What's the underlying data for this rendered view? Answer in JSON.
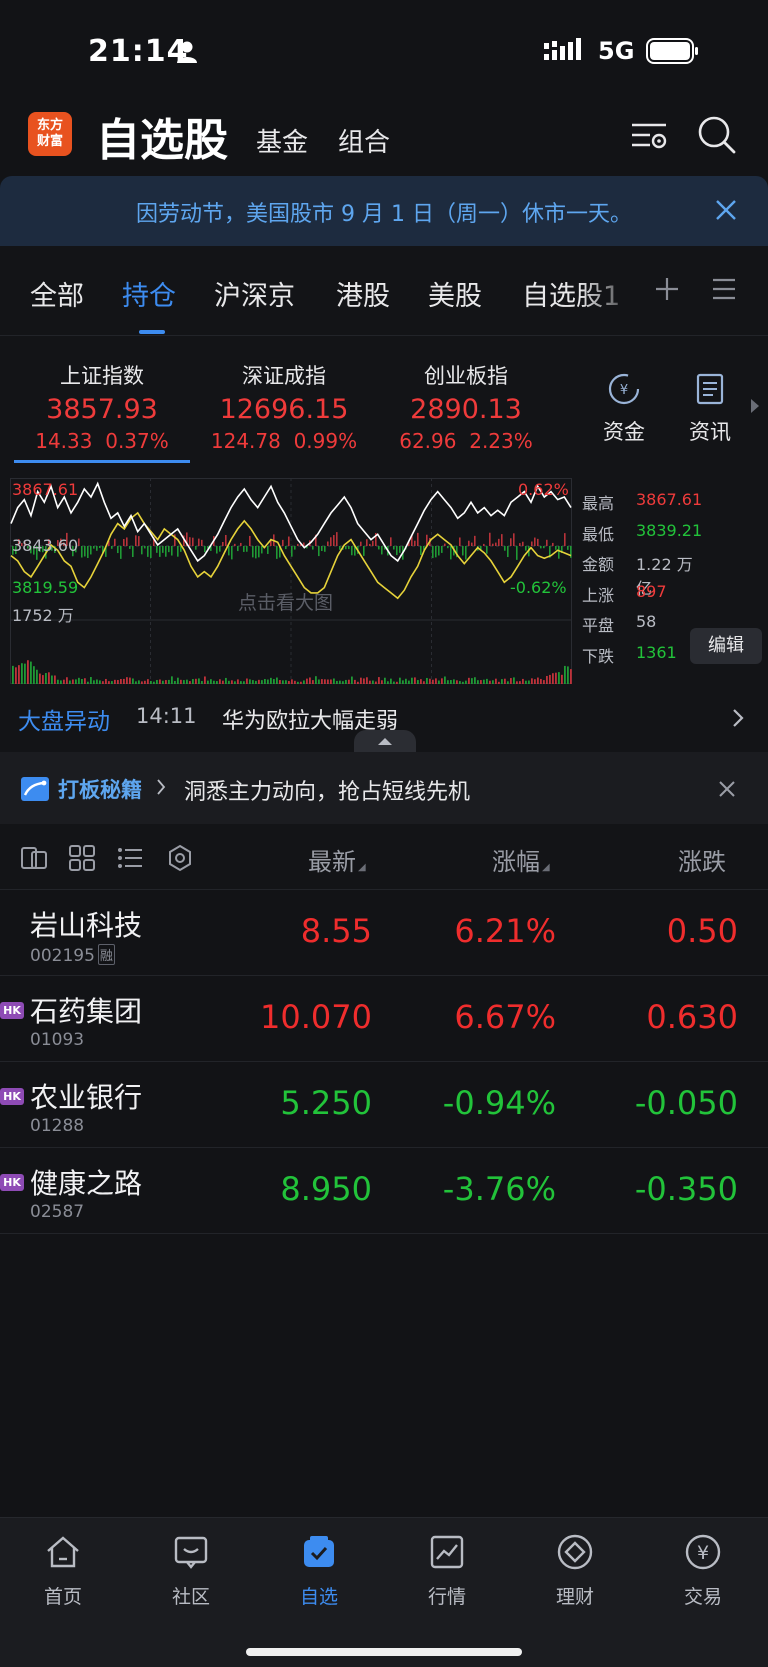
{
  "status_bar": {
    "time": "21:14",
    "network": "5G"
  },
  "header": {
    "logo_text": "东方\n财富",
    "title": "自选股",
    "tabs": [
      "基金",
      "组合"
    ]
  },
  "banner": {
    "text": "因劳动节，美国股市 9 月 1 日（周一）休市一天。"
  },
  "tabs": {
    "items": [
      "全部",
      "持仓",
      "沪深京",
      "港股",
      "美股",
      "自选股1"
    ],
    "active": "持仓"
  },
  "indices": [
    {
      "name": "上证指数",
      "value": "3857.93",
      "change": "14.33",
      "pct": "0.37%"
    },
    {
      "name": "深证成指",
      "value": "12696.15",
      "change": "124.78",
      "pct": "0.99%"
    },
    {
      "name": "创业板指",
      "value": "2890.13",
      "change": "62.96",
      "pct": "2.23%"
    }
  ],
  "quick_buttons": [
    {
      "label": "资金",
      "icon": "capital-flow-icon"
    },
    {
      "label": "资讯",
      "icon": "news-icon"
    }
  ],
  "chart": {
    "y_high": "3867.61",
    "y_mid": "3843.60",
    "y_low": "3819.59",
    "pct_high": "0.62%",
    "pct_low": "-0.62%",
    "volume_label": "1752 万",
    "hint": "点击看大图"
  },
  "chart_data": {
    "type": "line",
    "ylim": [
      3819.59,
      3867.61
    ],
    "series": [
      {
        "values": [
          3852,
          3858,
          3861,
          3855,
          3864,
          3860,
          3866,
          3858,
          3862,
          3856,
          3860,
          3865,
          3862,
          3867,
          3860,
          3854,
          3856,
          3851,
          3855,
          3849,
          3852,
          3848,
          3844,
          3846,
          3848,
          3850,
          3846,
          3842,
          3838,
          3840,
          3844,
          3848,
          3853,
          3858,
          3862,
          3865,
          3861,
          3858,
          3862,
          3866,
          3860,
          3856,
          3851,
          3846,
          3843,
          3845,
          3848,
          3852,
          3856,
          3859,
          3862,
          3858,
          3852,
          3849,
          3846,
          3848,
          3844,
          3840,
          3838,
          3842,
          3847,
          3852,
          3857,
          3861,
          3864,
          3861,
          3858,
          3854,
          3856,
          3860,
          3856,
          3858,
          3855,
          3857,
          3855,
          3860,
          3862,
          3864,
          3860,
          3866,
          3862,
          3864,
          3861,
          3862,
          3858
        ]
      },
      {
        "values": [
          3840,
          3838,
          3834,
          3832,
          3836,
          3840,
          3844,
          3842,
          3838,
          3836,
          3830,
          3828,
          3832,
          3837,
          3842,
          3848,
          3852,
          3850,
          3854,
          3856,
          3852,
          3849,
          3846,
          3850,
          3848,
          3846,
          3842,
          3836,
          3832,
          3834,
          3832,
          3836,
          3841,
          3846,
          3850,
          3853,
          3850,
          3846,
          3843,
          3846,
          3845,
          3840,
          3836,
          3832,
          3828,
          3826,
          3826,
          3828,
          3834,
          3840,
          3844,
          3846,
          3842,
          3838,
          3834,
          3830,
          3828,
          3826,
          3824,
          3827,
          3832,
          3836,
          3842,
          3846,
          3848,
          3846,
          3844,
          3840,
          3837,
          3840,
          3843,
          3841,
          3838,
          3834,
          3830,
          3832,
          3836,
          3840,
          3843,
          3840,
          3839,
          3840,
          3842,
          3841,
          3840
        ]
      }
    ]
  },
  "market_stats": [
    {
      "label": "最高",
      "value": "3867.61",
      "color": "#ef3b3b"
    },
    {
      "label": "最低",
      "value": "3839.21",
      "color": "#22c33a"
    },
    {
      "label": "金额",
      "value": "1.22 万亿",
      "color": "#b9bcc4"
    },
    {
      "label": "上涨",
      "value": "897",
      "color": "#ef3b3b"
    },
    {
      "label": "平盘",
      "value": "58",
      "color": "#b9bcc4"
    },
    {
      "label": "下跌",
      "value": "1361",
      "color": "#22c33a"
    }
  ],
  "edit_label": "编辑",
  "market_alert": {
    "tag": "大盘异动",
    "time": "14:11",
    "message": "华为欧拉大幅走弱"
  },
  "promo": {
    "tag": "打板秘籍",
    "text": "洞悉主力动向，抢占短线先机"
  },
  "list_header": {
    "columns": [
      "最新",
      "涨幅",
      "涨跌"
    ]
  },
  "stocks": [
    {
      "name": "岩山科技",
      "code": "002195",
      "badge": "融",
      "market": "",
      "price": "8.55",
      "pct": "6.21%",
      "change": "0.50",
      "dir": "up"
    },
    {
      "name": "石药集团",
      "code": "01093",
      "badge": "",
      "market": "HK",
      "price": "10.070",
      "pct": "6.67%",
      "change": "0.630",
      "dir": "up"
    },
    {
      "name": "农业银行",
      "code": "01288",
      "badge": "",
      "market": "HK",
      "price": "5.250",
      "pct": "-0.94%",
      "change": "-0.050",
      "dir": "dn"
    },
    {
      "name": "健康之路",
      "code": "02587",
      "badge": "",
      "market": "HK",
      "price": "8.950",
      "pct": "-3.76%",
      "change": "-0.350",
      "dir": "dn"
    }
  ],
  "bottom_nav": [
    {
      "label": "首页",
      "icon": "home-icon"
    },
    {
      "label": "社区",
      "icon": "community-icon"
    },
    {
      "label": "自选",
      "icon": "watchlist-icon",
      "active": true
    },
    {
      "label": "行情",
      "icon": "market-icon"
    },
    {
      "label": "理财",
      "icon": "wealth-icon"
    },
    {
      "label": "交易",
      "icon": "trade-icon"
    }
  ]
}
